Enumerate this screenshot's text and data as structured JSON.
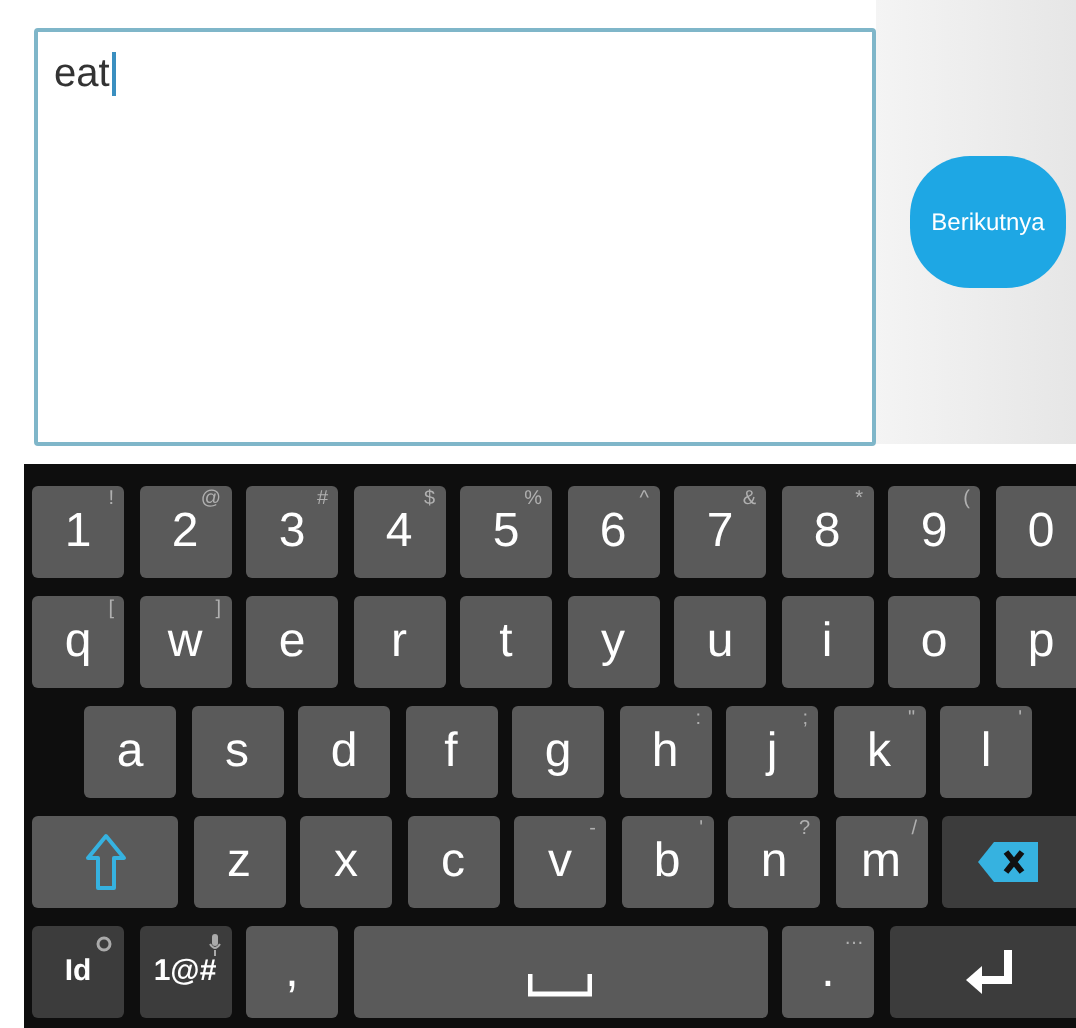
{
  "input": {
    "value": "eat"
  },
  "next_button": {
    "label": "Berikutnya"
  },
  "keyboard": {
    "rows": [
      [
        {
          "kind": "char",
          "label": "1",
          "hint": "!"
        },
        {
          "kind": "char",
          "label": "2",
          "hint": "@"
        },
        {
          "kind": "char",
          "label": "3",
          "hint": "#"
        },
        {
          "kind": "char",
          "label": "4",
          "hint": "$"
        },
        {
          "kind": "char",
          "label": "5",
          "hint": "%"
        },
        {
          "kind": "char",
          "label": "6",
          "hint": "^"
        },
        {
          "kind": "char",
          "label": "7",
          "hint": "&"
        },
        {
          "kind": "char",
          "label": "8",
          "hint": "*"
        },
        {
          "kind": "char",
          "label": "9",
          "hint": "("
        },
        {
          "kind": "char",
          "label": "0"
        }
      ],
      [
        {
          "kind": "char",
          "label": "q",
          "hint": "["
        },
        {
          "kind": "char",
          "label": "w",
          "hint": "]"
        },
        {
          "kind": "char",
          "label": "e"
        },
        {
          "kind": "char",
          "label": "r"
        },
        {
          "kind": "char",
          "label": "t"
        },
        {
          "kind": "char",
          "label": "y"
        },
        {
          "kind": "char",
          "label": "u"
        },
        {
          "kind": "char",
          "label": "i"
        },
        {
          "kind": "char",
          "label": "o"
        },
        {
          "kind": "char",
          "label": "p"
        }
      ],
      [
        {
          "kind": "char",
          "label": "a"
        },
        {
          "kind": "char",
          "label": "s"
        },
        {
          "kind": "char",
          "label": "d"
        },
        {
          "kind": "char",
          "label": "f"
        },
        {
          "kind": "char",
          "label": "g"
        },
        {
          "kind": "char",
          "label": "h",
          "hint": ":"
        },
        {
          "kind": "char",
          "label": "j",
          "hint": ";"
        },
        {
          "kind": "char",
          "label": "k",
          "hint": "\""
        },
        {
          "kind": "char",
          "label": "l",
          "hint": "'"
        }
      ],
      [
        {
          "kind": "shift"
        },
        {
          "kind": "char",
          "label": "z"
        },
        {
          "kind": "char",
          "label": "x"
        },
        {
          "kind": "char",
          "label": "c"
        },
        {
          "kind": "char",
          "label": "v",
          "hint": "-"
        },
        {
          "kind": "char",
          "label": "b",
          "hint": "'"
        },
        {
          "kind": "char",
          "label": "n",
          "hint": "?"
        },
        {
          "kind": "char",
          "label": "m",
          "hint": "/"
        },
        {
          "kind": "backspace"
        }
      ],
      [
        {
          "kind": "lang",
          "label": "Id"
        },
        {
          "kind": "symbols",
          "label": "1@#"
        },
        {
          "kind": "char",
          "label": ","
        },
        {
          "kind": "space"
        },
        {
          "kind": "char",
          "label": ".",
          "hint": "…"
        },
        {
          "kind": "enter"
        }
      ]
    ]
  }
}
